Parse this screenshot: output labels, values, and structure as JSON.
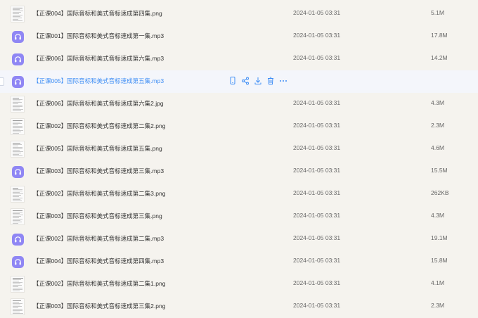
{
  "files": [
    {
      "name": "【正课004】国际音标和美式音标速成第四集.png",
      "date": "2024-01-05 03:31",
      "size": "5.1M",
      "kind": "image-icon",
      "hovered": false
    },
    {
      "name": "【正课001】国际音标和美式音标速成第一集.mp3",
      "date": "2024-01-05 03:31",
      "size": "17.8M",
      "kind": "audio-icon",
      "hovered": false
    },
    {
      "name": "【正课006】国际音标和美式音标速成第六集.mp3",
      "date": "2024-01-05 03:31",
      "size": "14.2M",
      "kind": "audio-icon",
      "hovered": false
    },
    {
      "name": "【正课005】国际音标和美式音标速成第五集.mp3",
      "date": "",
      "size": "",
      "kind": "audio-icon",
      "hovered": true
    },
    {
      "name": "【正课006】国际音标和美式音标速成第六集2.jpg",
      "date": "2024-01-05 03:31",
      "size": "4.3M",
      "kind": "image-icon",
      "hovered": false
    },
    {
      "name": "【正课002】国际音标和美式音标速成第二集2.png",
      "date": "2024-01-05 03:31",
      "size": "2.3M",
      "kind": "image-icon",
      "hovered": false
    },
    {
      "name": "【正课005】国际音标和美式音标速成第五集.png",
      "date": "2024-01-05 03:31",
      "size": "4.6M",
      "kind": "image-icon",
      "hovered": false
    },
    {
      "name": "【正课003】国际音标和美式音标速成第三集.mp3",
      "date": "2024-01-05 03:31",
      "size": "15.5M",
      "kind": "audio-icon",
      "hovered": false
    },
    {
      "name": "【正课002】国际音标和美式音标速成第二集3.png",
      "date": "2024-01-05 03:31",
      "size": "262KB",
      "kind": "image-icon",
      "hovered": false
    },
    {
      "name": "【正课003】国际音标和美式音标速成第三集.png",
      "date": "2024-01-05 03:31",
      "size": "4.3M",
      "kind": "image-icon",
      "hovered": false
    },
    {
      "name": "【正课002】国际音标和美式音标速成第二集.mp3",
      "date": "2024-01-05 03:31",
      "size": "19.1M",
      "kind": "audio-icon",
      "hovered": false
    },
    {
      "name": "【正课004】国际音标和美式音标速成第四集.mp3",
      "date": "2024-01-05 03:31",
      "size": "15.8M",
      "kind": "audio-icon",
      "hovered": false
    },
    {
      "name": "【正课002】国际音标和美式音标速成第二集1.png",
      "date": "2024-01-05 03:31",
      "size": "4.1M",
      "kind": "image-icon",
      "hovered": false
    },
    {
      "name": "【正课003】国际音标和美式音标速成第三集2.png",
      "date": "2024-01-05 03:31",
      "size": "2.3M",
      "kind": "image-icon",
      "hovered": false
    }
  ],
  "hover_actions": [
    "phone-icon",
    "share-icon",
    "download-icon",
    "delete-icon",
    "more-icon"
  ],
  "colors": {
    "background": "#f5f3ee",
    "hover_row": "#f4f6fb",
    "hover_text": "#3d8df5",
    "audio_icon": "#8f86f4",
    "action_icon": "#3d8df5"
  }
}
